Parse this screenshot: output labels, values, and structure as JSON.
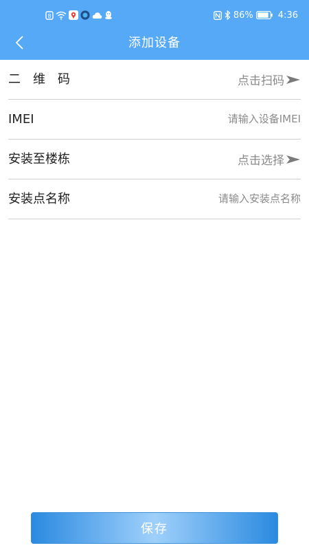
{
  "status_bar": {
    "battery": "86%",
    "time": "4:36"
  },
  "header": {
    "title": "添加设备"
  },
  "form": {
    "qr": {
      "label": "二维码",
      "action": "点击扫码"
    },
    "imei": {
      "label": "IMEI",
      "placeholder": "请输入设备IMEI"
    },
    "building": {
      "label": "安装至楼栋",
      "action": "点击选择"
    },
    "location_name": {
      "label": "安装点名称",
      "placeholder": "请输入安装点名称"
    }
  },
  "footer": {
    "save_label": "保存"
  },
  "colors": {
    "header_bg": "#55a9f6",
    "divider": "#cfcfcf",
    "placeholder_text": "#8a8a8a",
    "label_text": "#222222",
    "button_gradient_edge": "#2b8ae0",
    "button_gradient_center": "#9fd0fb"
  },
  "icons": {
    "back": "chevron-left-icon",
    "row_action": "arrow-right-icon"
  }
}
